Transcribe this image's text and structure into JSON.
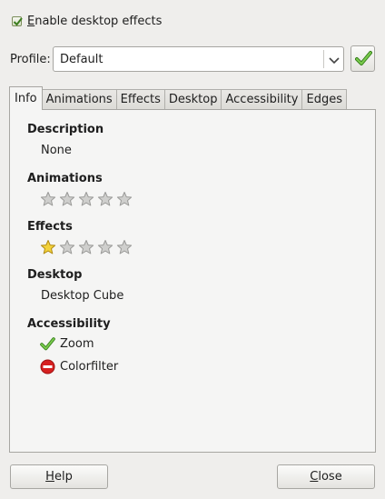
{
  "enable_effects": {
    "label_first": "E",
    "label_rest": "nable desktop effects",
    "checked": true
  },
  "profile": {
    "label": "Profile:",
    "value": "Default",
    "apply_icon": "checkmark-icon"
  },
  "tabs": [
    {
      "label": "Info",
      "active": true
    },
    {
      "label": "Animations",
      "active": false
    },
    {
      "label": "Effects",
      "active": false
    },
    {
      "label": "Desktop",
      "active": false
    },
    {
      "label": "Accessibility",
      "active": false
    },
    {
      "label": "Edges",
      "active": false
    }
  ],
  "info": {
    "description": {
      "title": "Description",
      "value": "None"
    },
    "animations": {
      "title": "Animations",
      "rating": 0,
      "max": 5
    },
    "effects": {
      "title": "Effects",
      "rating": 1,
      "max": 5
    },
    "desktop": {
      "title": "Desktop",
      "value": "Desktop Cube"
    },
    "accessibility": {
      "title": "Accessibility",
      "items": [
        {
          "label": "Zoom",
          "icon": "checkmark-icon",
          "status": "enabled"
        },
        {
          "label": "Colorfilter",
          "icon": "blocked-icon",
          "status": "disabled"
        }
      ]
    }
  },
  "buttons": {
    "help_first": "H",
    "help_rest": "elp",
    "close_first": "C",
    "close_rest": "lose"
  },
  "colors": {
    "star_active": "#f3d23a",
    "star_inactive": "#cfcfcd",
    "check_green": "#57a83a",
    "blocked_red": "#d62020"
  }
}
